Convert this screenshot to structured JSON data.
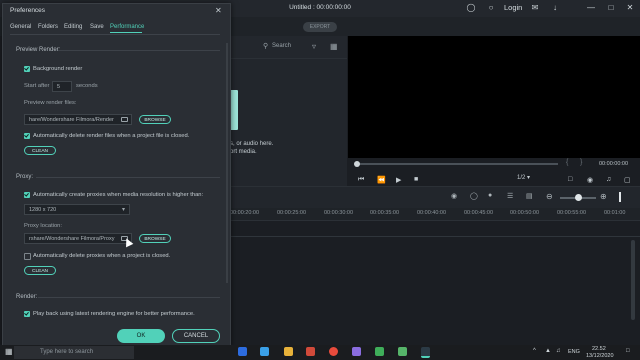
{
  "app": {
    "title": "Untitled : 00:00:00:00",
    "login": "Login",
    "export": "EXPORT",
    "icons": [
      "headset-icon",
      "bulb-icon",
      "user-icon",
      "mail-icon",
      "download-icon",
      "minimize-icon",
      "maximize-icon",
      "close-icon"
    ]
  },
  "media": {
    "search_placeholder": "Search",
    "hint_line_1": "s, or audio here.",
    "hint_line_2": "ort media."
  },
  "preview": {
    "timecode": "00:00:00:00",
    "ratio": "1/2",
    "bracket_left": "{",
    "bracket_right": "}"
  },
  "timeline": {
    "ticks": [
      "00:00:20:00",
      "00:00:25:00",
      "00:00:30:00",
      "00:00:35:00",
      "00:00:40:00",
      "00:00:45:00",
      "00:00:50:00",
      "00:00:55:00",
      "00:01:00"
    ]
  },
  "dialog": {
    "title": "Preferences",
    "tabs": [
      "General",
      "Folders",
      "Editing",
      "Save",
      "Performance"
    ],
    "active_tab": "Performance",
    "preview_render": {
      "section": "Preview Render:",
      "background_render_label": "Background render",
      "background_render_checked": true,
      "start_after_label": "Start after",
      "start_after_value": "5",
      "start_after_unit": "seconds",
      "files_label": "Preview render files:",
      "files_path": "hare/Wondershare Filmora/Render",
      "browse": "BROWSE",
      "auto_delete_label": "Automatically delete render files when a project file is closed.",
      "auto_delete_checked": true,
      "clean": "CLEAN"
    },
    "proxy": {
      "section": "Proxy:",
      "auto_create_label": "Automatically create proxies when media resolution is higher than:",
      "auto_create_checked": true,
      "resolution": "1280 x 720",
      "location_label": "Proxy location:",
      "location_path": "rshare/Wondershare Filmora/Proxy",
      "browse": "BROWSE",
      "auto_delete_label": "Automatically delete proxies when a project is closed.",
      "auto_delete_checked": false,
      "clean": "CLEAN"
    },
    "render": {
      "section": "Render:",
      "latest_engine_label": "Play back using latest rendering engine for better performance.",
      "latest_engine_checked": true
    },
    "ok": "OK",
    "cancel": "CANCEL"
  },
  "taskbar": {
    "search_placeholder": "Type here to search",
    "language": "ENG",
    "time": "22.52",
    "date": "13/12/2020"
  },
  "colors": {
    "accent": "#51d1b9",
    "dialog_bg": "#2a2e34",
    "app_bg": "#1b1e23"
  }
}
